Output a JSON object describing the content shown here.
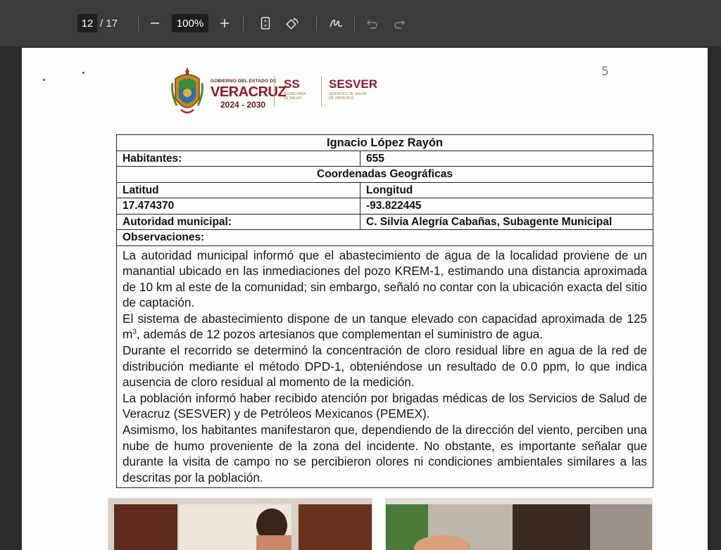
{
  "toolbar": {
    "current_page": "12",
    "page_total": "/ 17",
    "zoom": "100%",
    "icons": [
      "zoom-out-icon",
      "zoom-in-icon",
      "fit-page-icon",
      "rotate-icon",
      "draw-icon",
      "undo-icon",
      "redo-icon"
    ]
  },
  "page": {
    "page_number": "5",
    "header": {
      "gob_line1": "GOBIERNO DEL ESTADO DE",
      "gob_name": "VERACRUZ",
      "gob_years": "2024 - 2030",
      "ss_name": "SS",
      "ss_sub": "SECRETARÍA DE SALUD",
      "sesver_name": "SESVER",
      "sesver_sub": "SERVICIOS DE SALUD DE VERACRUZ"
    },
    "table": {
      "locality": "Ignacio López Rayón",
      "inhabitants_label": "Habitantes:",
      "inhabitants_value": "655",
      "coords_header": "Coordenadas Geográficas",
      "lat_label": "Latitud",
      "lon_label": "Longitud",
      "lat_value": "17.474370",
      "lon_value": "-93.822445",
      "authority_label": "Autoridad municipal:",
      "authority_value": "C. Silvia Alegría Cabañas, Subagente Municipal",
      "observations_label": "Observaciones:",
      "obs_p1": "La autoridad municipal informó que el abastecimiento de agua de la localidad proviene de un manantial ubicado en las inmediaciones del pozo KREM-1, estimando una distancia aproximada de 10 km al este de la comunidad; sin embargo, señaló no contar con la ubicación exacta del sitio de captación.",
      "obs_p2_a": "El sistema de abastecimiento dispone de un tanque elevado con capacidad aproximada de 125 m",
      "obs_p2_sup": "3",
      "obs_p2_b": ", además de 12 pozos artesianos que complementan el suministro de agua.",
      "obs_p3": "Durante el recorrido se determinó la concentración de cloro residual libre en agua de la red de distribución mediante el método DPD-1, obteniéndose un resultado de 0.0 ppm, lo que indica ausencia de cloro residual al momento de la medición.",
      "obs_p4": "La población informó haber recibido atención por brigadas médicas de los Servicios de Salud de Veracruz (SESVER) y de Petróleos Mexicanos (PEMEX).",
      "obs_p5": "Asimismo, los habitantes manifestaron que, dependiendo de la dirección del viento, perciben una nube de humo proveniente de la zona del incidente. No obstante, es importante señalar que durante la visita de campo no se percibieron olores ni condiciones ambientales similares a las descritas por la población."
    }
  }
}
